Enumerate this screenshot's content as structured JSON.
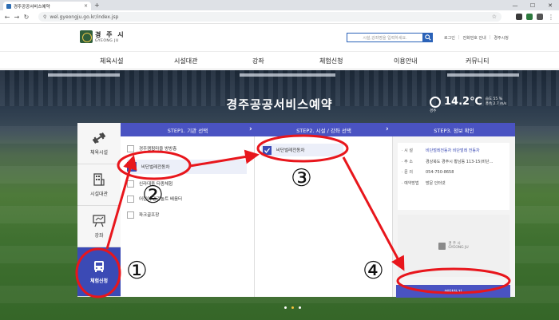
{
  "browser": {
    "tab_title": "경주공공서비스예약",
    "tab_close": "×",
    "new_tab": "+",
    "url": "wel.gyeongju.go.kr/index.jsp"
  },
  "header": {
    "logo_name": "경 주 시",
    "logo_sub": "GYEONG JU",
    "search_placeholder": "시설,강좌명을 입력하세요.",
    "util_links": [
      "로그인",
      "전화번호 안내",
      "경주시청"
    ]
  },
  "gnb": [
    "체육시설",
    "시설대관",
    "강좌",
    "체험신청",
    "이용안내",
    "커뮤니티"
  ],
  "hero": {
    "title": "경주공공서비스예약",
    "weather": {
      "temp": "14.2℃",
      "detail1": "습도 55 %",
      "detail2": "풍속 2.7 m/s",
      "location": "경주"
    }
  },
  "sidebar": [
    {
      "label": "체육시설",
      "active": false
    },
    {
      "label": "시설대관",
      "active": false
    },
    {
      "label": "강좌",
      "active": false
    },
    {
      "label": "체험신청",
      "active": true
    }
  ],
  "steps": {
    "step1": "STEP1. 기관 선택",
    "step2": "STEP2. 시설 / 강좌 선택",
    "step3": "STEP3. 정보 확인"
  },
  "facilities": [
    {
      "label": "경주캠핑마을 방방층",
      "selected": false
    },
    {
      "label": "비단벌레전동차",
      "selected": true
    },
    {
      "label": "신라대종 타종체험",
      "selected": false
    },
    {
      "label": "어린이 건강놀트 배움터",
      "selected": false
    },
    {
      "label": "파크골프장",
      "selected": false
    }
  ],
  "institution": {
    "label": "비단벌레전동차",
    "selected": true
  },
  "info": [
    {
      "key": "· 시 설",
      "value": "비단벌레전동차 비단벌레 전동차",
      "link": true
    },
    {
      "key": "· 주 소",
      "value": "경상북도 경주시 황남동 113-15(비단...",
      "link": false
    },
    {
      "key": "· 문 의",
      "value": "054-750-8658",
      "link": false
    },
    {
      "key": "· 예약방법",
      "value": "방문 인터넷",
      "link": false
    }
  ],
  "thumb_logo": {
    "name": "경 주 시",
    "sub": "GYEONG JU"
  },
  "reserve_button": "예약하기",
  "annotations": [
    "①",
    "②",
    "③",
    "④"
  ],
  "colors": {
    "primary": "#4a53c2",
    "sidebar_active": "#3b4ab5",
    "annotation_red": "#e8161c",
    "accent_dot": "#f6c43a"
  }
}
